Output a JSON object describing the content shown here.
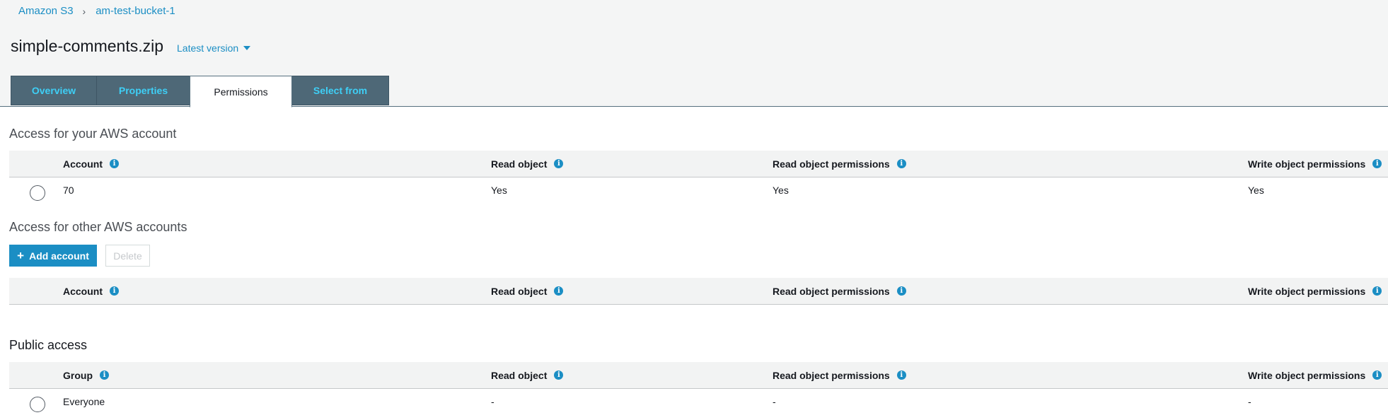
{
  "breadcrumb": {
    "root": "Amazon S3",
    "separator": "›",
    "bucket": "am-test-bucket-1"
  },
  "object": {
    "name": "simple-comments.zip",
    "version_label": "Latest version"
  },
  "tabs": [
    {
      "label": "Overview",
      "active": false
    },
    {
      "label": "Properties",
      "active": false
    },
    {
      "label": "Permissions",
      "active": true
    },
    {
      "label": "Select from",
      "active": false
    }
  ],
  "own_account": {
    "title": "Access for your AWS account",
    "columns": [
      "Account",
      "Read object",
      "Read object permissions",
      "Write object permissions"
    ],
    "rows": [
      {
        "account": "70",
        "read_object": "Yes",
        "read_permissions": "Yes",
        "write_permissions": "Yes"
      }
    ]
  },
  "other_accounts": {
    "title": "Access for other AWS accounts",
    "add_label": "Add account",
    "delete_label": "Delete",
    "columns": [
      "Account",
      "Read object",
      "Read object permissions",
      "Write object permissions"
    ]
  },
  "public_access": {
    "title": "Public access",
    "columns": [
      "Group",
      "Read object",
      "Read object permissions",
      "Write object permissions"
    ],
    "rows": [
      {
        "group": "Everyone",
        "read_object": "-",
        "read_permissions": "-",
        "write_permissions": "-"
      }
    ]
  },
  "icons": {
    "info": "info-icon",
    "plus": "plus-icon",
    "caret": "caret-down-icon"
  },
  "colors": {
    "accent": "#1b8ec4",
    "tab_bg": "#4e6877",
    "tab_text": "#3ecff6"
  }
}
